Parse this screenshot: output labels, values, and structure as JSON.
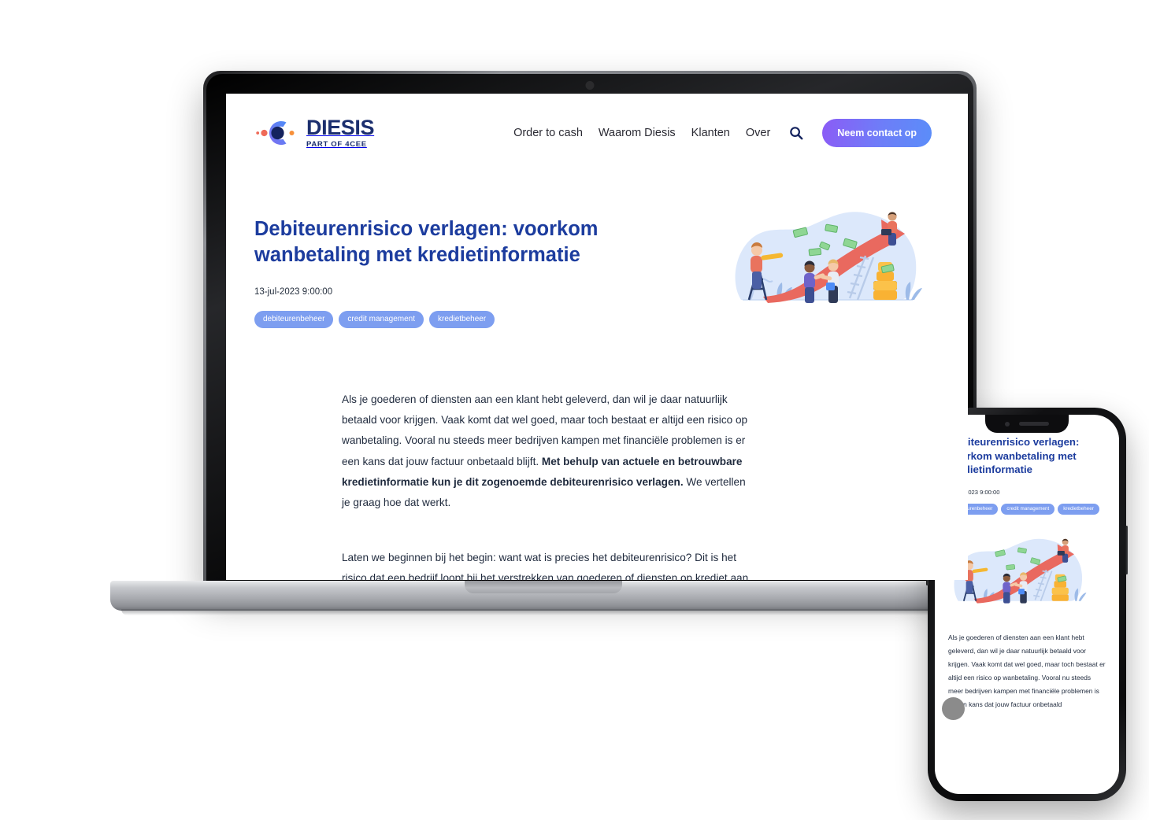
{
  "brand": {
    "name": "DIESIS",
    "tagline": "PART OF 4CEE",
    "logo_icon": "diesis-c-logo-icon",
    "colors": {
      "navy": "#1c2f6e",
      "coral": "#ef6a58",
      "orange": "#f7903a",
      "gradient_start": "#7f6df0",
      "gradient_end": "#4e8cf7"
    }
  },
  "nav": {
    "links": [
      {
        "label": "Order to cash"
      },
      {
        "label": "Waarom Diesis"
      },
      {
        "label": "Klanten"
      },
      {
        "label": "Over"
      }
    ],
    "search_icon": "search-icon",
    "cta_label": "Neem contact op",
    "cta_gradient": "#8b5cf6 → #5b8df9"
  },
  "article": {
    "title": "Debiteurenrisico verlagen: voorkom wanbetaling met kredietinformatie",
    "date": "13-jul-2023 9:00:00",
    "title_color": "#1c3c9e",
    "tags": [
      {
        "label": "debiteurenbeheer"
      },
      {
        "label": "credit management"
      },
      {
        "label": "kredietbeheer"
      }
    ],
    "tag_color": "#7d9ef0",
    "paragraph_1_a": "Als je goederen of diensten aan een klant hebt geleverd, dan wil je daar natuurlijk betaald voor krijgen. Vaak komt dat wel goed, maar toch bestaat er altijd een risico op wanbetaling. Vooral nu steeds meer bedrijven kampen met financiële problemen is er een kans dat jouw factuur onbetaald blijft. ",
    "paragraph_1_bold": "Met behulp van actuele en betrouwbare kredietinformatie kun je dit zogenoemde debiteurenrisico verlagen.",
    "paragraph_1_c": " We vertellen je graag hoe dat werkt.",
    "paragraph_2": "Laten we beginnen bij het begin: want wat is precies het debiteurenrisico? Dit is het risico dat een bedrijf loopt bij het verstrekken van goederen of diensten op krediet aan klanten. Kortom: wanneer je eerst iets levert en pas achteraf een factuur stuurt en betaald krijgt. Het debiteurenrisico draait",
    "mobile_paragraph": "Als je goederen of diensten aan een klant hebt geleverd, dan wil je daar natuurlijk betaald voor krijgen. Vaak komt dat wel goed, maar toch bestaat er altijd een risico op wanbetaling. Vooral nu steeds meer bedrijven kampen met financiële problemen is er een kans dat jouw factuur onbetaald"
  },
  "illustration": {
    "name": "growth-arrow-people-illustration",
    "blob_color": "#dce8fb",
    "arrow_color": "#e9695f",
    "coin_color": "#f9b233",
    "money_color": "#8fd694"
  },
  "devices": {
    "laptop": {
      "name": "laptop-mockup",
      "webcam_icon": "webcam-icon"
    },
    "phone": {
      "name": "phone-mockup",
      "camera_icon": "front-camera-icon",
      "speaker_icon": "earpiece-speaker-icon",
      "chat_widget_icon": "chat-widget-icon"
    }
  }
}
